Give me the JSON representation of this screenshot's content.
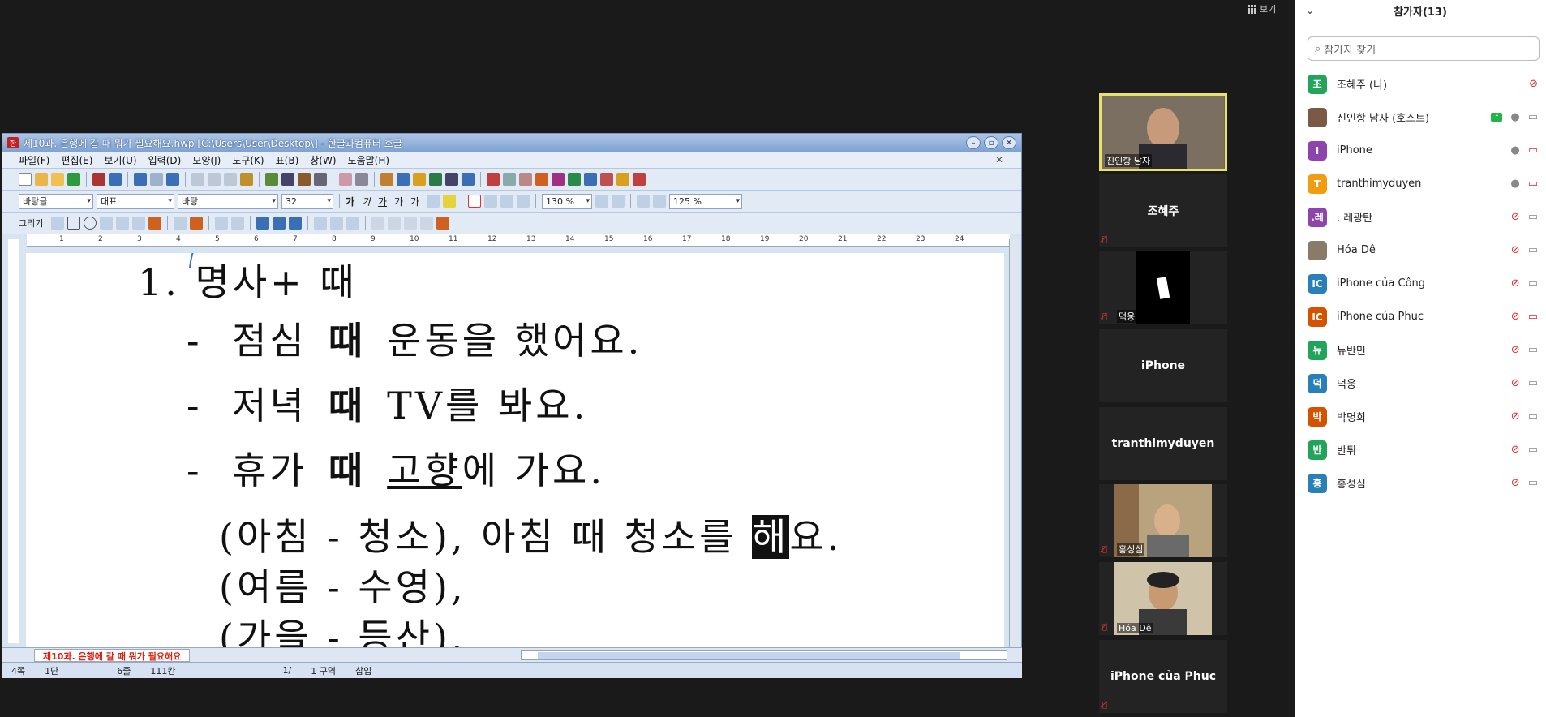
{
  "top_right": {
    "label": "보기"
  },
  "hwp": {
    "title": "제10과. 은행에 갈 때 뭐가 필요해요.hwp [C:\\Users\\User\\Desktop\\] - 한글과컴퓨터 호글",
    "menu": [
      "파일(F)",
      "편집(E)",
      "보기(U)",
      "입력(D)",
      "모양(J)",
      "도구(K)",
      "표(B)",
      "창(W)",
      "도움말(H)"
    ],
    "format_bar": {
      "style": "바탕글",
      "style_kind": "대표",
      "font": "바탕",
      "size": "32",
      "zoom1": "130 %",
      "zoom2": "125 %"
    },
    "draw_label": "그리기",
    "ruler_ticks": [
      "1",
      "2",
      "3",
      "4",
      "5",
      "6",
      "7",
      "8",
      "9",
      "10",
      "11",
      "12",
      "13",
      "14",
      "15",
      "16",
      "17",
      "18",
      "19",
      "20",
      "21",
      "22",
      "23",
      "24"
    ],
    "doc_lines": [
      {
        "prefix": "1.",
        "text": "명사+ 때"
      },
      {
        "prefix": "-",
        "pre": "점심",
        "bold": "때",
        "post": "운동을 했어요."
      },
      {
        "prefix": "-",
        "pre": "저녁",
        "bold": "때",
        "post": "TV를 봐요."
      },
      {
        "prefix": "-",
        "pre": "휴가",
        "bold": "때",
        "underline": "고향",
        "post": "에 가요."
      },
      {
        "text": "(아침 - 청소), 아침 때 청소를 ",
        "highlight": "해",
        "post": "요."
      },
      {
        "text": "(여름 - 수영),"
      },
      {
        "text": "(가을 - 등산)."
      }
    ],
    "doc_tab": "제10과. 은행에 갈 때 뭐가 필요해요",
    "status": [
      "4쪽",
      "1단",
      "6줄",
      "111칸",
      "1/",
      "1 구역",
      "삽입"
    ]
  },
  "videos": [
    {
      "name": "진인항 남자",
      "type": "camera"
    },
    {
      "name": "조혜주",
      "type": "name"
    },
    {
      "name": "덕웅",
      "type": "camera-small"
    },
    {
      "name": "iPhone",
      "type": "name"
    },
    {
      "name": "tranthimyduyen",
      "type": "name"
    },
    {
      "name": "홍성심",
      "type": "camera"
    },
    {
      "name": "Hóa Dê",
      "type": "camera"
    },
    {
      "name": "iPhone của Phuc",
      "type": "name"
    }
  ],
  "participants": {
    "header": "참가자(13)",
    "search_placeholder": "참가자 찾기",
    "list": [
      {
        "avatar": "조",
        "color": "#22a55b",
        "name": "조혜주 (나)",
        "mic": "off",
        "cam": "none"
      },
      {
        "avatar": "",
        "color": "#7a5a45",
        "name": "진인항 남자 (호스트)",
        "mic": "on",
        "cam": "on",
        "share": true
      },
      {
        "avatar": "I",
        "color": "#8e44ad",
        "name": "iPhone",
        "mic": "on",
        "cam": "off"
      },
      {
        "avatar": "T",
        "color": "#f39c12",
        "name": "tranthimyduyen",
        "mic": "on",
        "cam": "off"
      },
      {
        "avatar": ".레",
        "color": "#8e44ad",
        "name": ". 레광탄",
        "mic": "off",
        "cam": "on"
      },
      {
        "avatar": "",
        "color": "#8a7a6a",
        "name": "Hóa Dê",
        "mic": "off",
        "cam": "on"
      },
      {
        "avatar": "IC",
        "color": "#2980b9",
        "name": "iPhone của Công",
        "mic": "off",
        "cam": "on"
      },
      {
        "avatar": "IC",
        "color": "#d35400",
        "name": "iPhone của Phuc",
        "mic": "off",
        "cam": "off"
      },
      {
        "avatar": "뉴",
        "color": "#22a55b",
        "name": "뉴반민",
        "mic": "off",
        "cam": "on"
      },
      {
        "avatar": "덕",
        "color": "#2980b9",
        "name": "덕웅",
        "mic": "off",
        "cam": "on"
      },
      {
        "avatar": "박",
        "color": "#d35400",
        "name": "박명희",
        "mic": "off",
        "cam": "on"
      },
      {
        "avatar": "반",
        "color": "#22a55b",
        "name": "반튀",
        "mic": "off",
        "cam": "on"
      },
      {
        "avatar": "홍",
        "color": "#2980b9",
        "name": "홍성심",
        "mic": "off",
        "cam": "on"
      }
    ]
  }
}
